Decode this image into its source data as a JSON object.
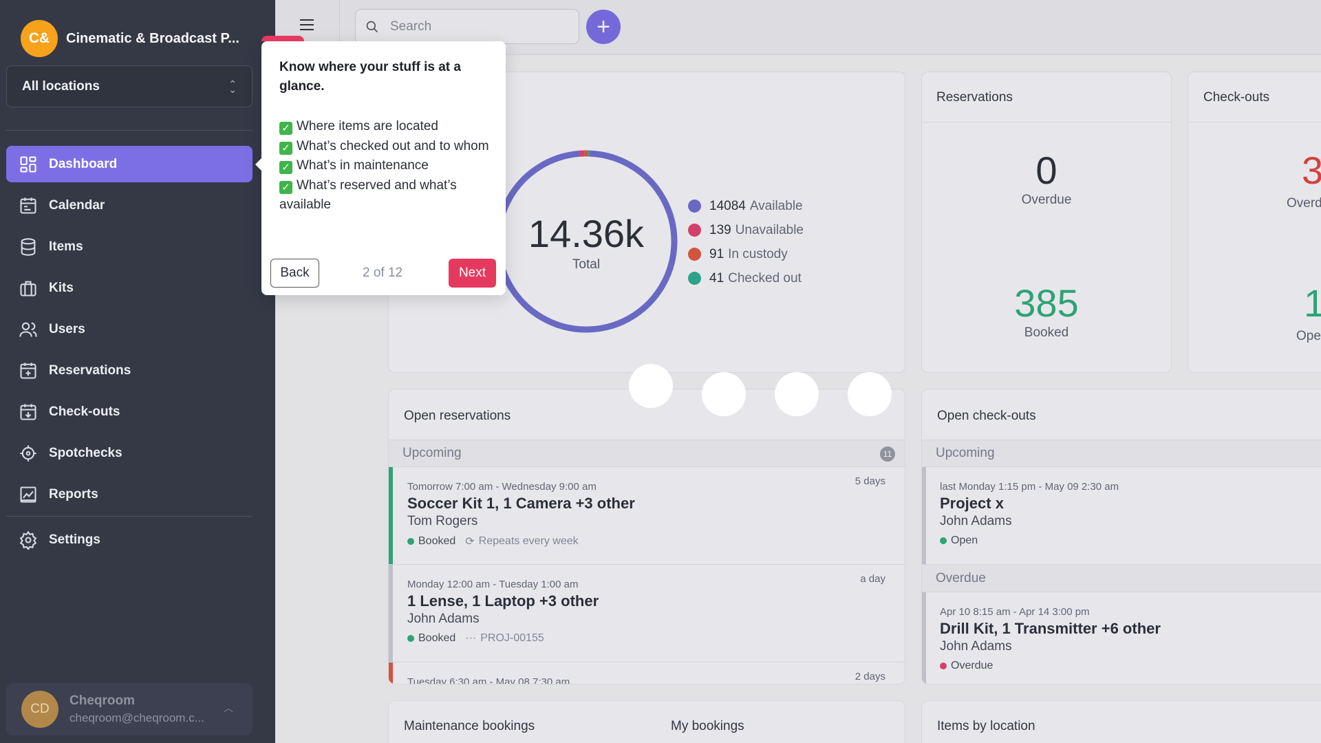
{
  "org": {
    "initials": "C&",
    "name": "Cinematic & Broadcast P..."
  },
  "location_select": {
    "value": "All locations"
  },
  "nav": [
    {
      "label": "Dashboard",
      "icon": "dashboard-icon",
      "active": true
    },
    {
      "label": "Calendar",
      "icon": "calendar-icon"
    },
    {
      "label": "Items",
      "icon": "database-icon"
    },
    {
      "label": "Kits",
      "icon": "kit-icon"
    },
    {
      "label": "Users",
      "icon": "users-icon"
    },
    {
      "label": "Reservations",
      "icon": "calendar-plus-icon"
    },
    {
      "label": "Check-outs",
      "icon": "calendar-checkout-icon"
    },
    {
      "label": "Spotchecks",
      "icon": "crosshair-icon"
    },
    {
      "label": "Reports",
      "icon": "chart-icon"
    },
    {
      "label": "Settings",
      "icon": "gear-icon"
    }
  ],
  "user": {
    "initials": "CD",
    "name": "Cheqroom",
    "email": "cheqroom@cheqroom.c..."
  },
  "search": {
    "placeholder": "Search"
  },
  "items_summary": {
    "total": "14.36k",
    "total_label": "Total",
    "legend": [
      {
        "count": "14084",
        "label": "Available",
        "color": "#6f6fd0",
        "value": 14084
      },
      {
        "count": "139",
        "label": "Unavailable",
        "color": "#e0456f",
        "value": 139
      },
      {
        "count": "91",
        "label": "In custody",
        "color": "#e2583e",
        "value": 91
      },
      {
        "count": "41",
        "label": "Checked out",
        "color": "#2fae91",
        "value": 41
      }
    ]
  },
  "reservations": {
    "title": "Reservations",
    "overdue": "0",
    "overdue_label": "Overdue",
    "booked": "385",
    "booked_label": "Booked"
  },
  "checkouts": {
    "title": "Check-outs",
    "overdue": "3",
    "overdue_label": "Overd",
    "open": "1",
    "open_label": "Ope"
  },
  "open_reservations": {
    "title": "Open reservations",
    "upcoming_label": "Upcoming",
    "upcoming_count": "11",
    "rows": [
      {
        "dates": "Tomorrow 7:00 am - Wednesday 9:00 am",
        "title": "Soccer Kit 1, 1 Camera +3 other",
        "user": "Tom Rogers",
        "status": "Booked",
        "extra": "Repeats every week",
        "duration": "5 days",
        "bar_color": "#2fae7a"
      },
      {
        "dates": "Monday 12:00 am - Tuesday 1:00 am",
        "title": "1 Lense, 1 Laptop +3 other",
        "user": "John Adams",
        "status": "Booked",
        "extra": "PROJ-00155",
        "duration": "a day",
        "bar_color": "#cdced6"
      },
      {
        "dates": "Tuesday 6:30 am - May 08 7:30 am",
        "duration": "2 days",
        "bar_color": "#e2583e"
      }
    ]
  },
  "open_checkouts": {
    "title": "Open check-outs",
    "upcoming_label": "Upcoming",
    "overdue_label": "Overdue",
    "rows": [
      {
        "dates": "last Monday 1:15 pm - May 09 2:30 am",
        "title": "Project x",
        "user": "John Adams",
        "status": "Open",
        "status_color": "#2fae7a"
      },
      {
        "dates": "Apr 10 8:15 am - Apr 14 3:00 pm",
        "title": "Drill Kit, 1 Transmitter +6 other",
        "user": "John Adams",
        "status": "Overdue",
        "status_color": "#e0456f"
      }
    ]
  },
  "bottom": {
    "maintenance": "Maintenance bookings",
    "my_bookings": "My bookings",
    "items_by_location": "Items by location"
  },
  "tour": {
    "title": "Know where your stuff is at a glance.",
    "items": [
      "Where items are located",
      "What’s checked out and to whom",
      "What’s in maintenance",
      "What’s reserved and what’s available"
    ],
    "back": "Back",
    "progress": "2 of 12",
    "next": "Next"
  },
  "colors": {
    "accent": "#7c6fe6",
    "sidebar": "#353946",
    "danger": "#e6395f",
    "success": "#2fae7a"
  }
}
